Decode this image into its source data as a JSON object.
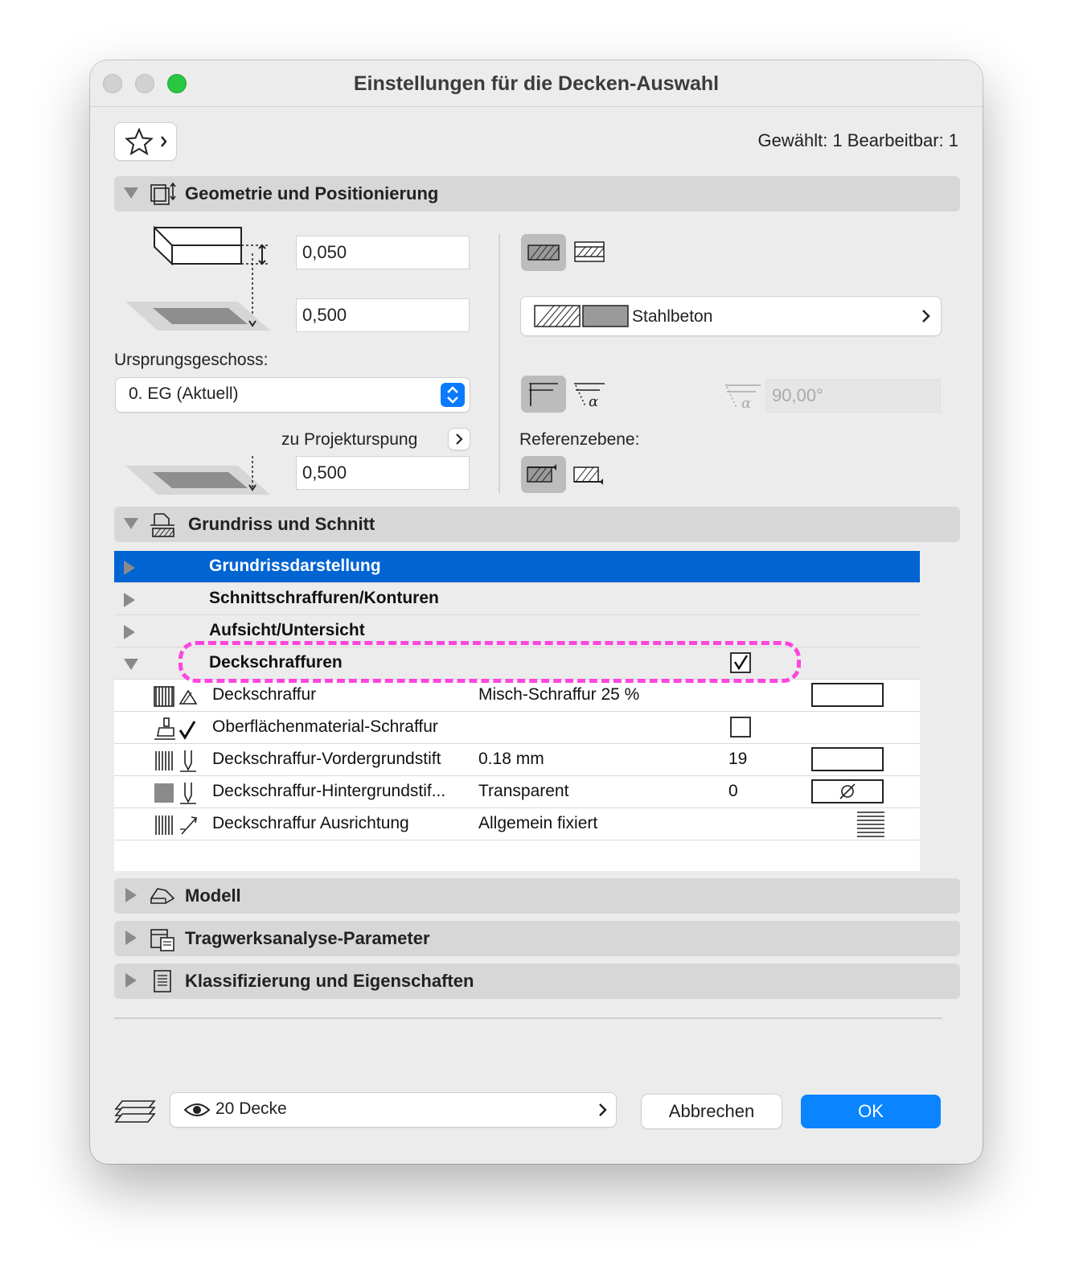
{
  "window": {
    "title": "Einstellungen für die Decken-Auswahl"
  },
  "header": {
    "selection_info": "Gewählt: 1 Bearbeitbar: 1"
  },
  "sections": {
    "geometry": "Geometrie und Positionierung",
    "floorplan": "Grundriss und Schnitt",
    "model": "Modell",
    "structural": "Tragwerksanalyse-Parameter",
    "classification": "Klassifizierung und Eigenschaften"
  },
  "geometry": {
    "thickness": "0,050",
    "offset": "0,500",
    "home_story_label": "Ursprungsgeschoss:",
    "home_story_value": "0. EG (Aktuell)",
    "to_project_zero_label": "zu Projekturspung",
    "to_project_zero_value": "0,500",
    "material_name": "Stahlbeton",
    "angle_value": "90,00°",
    "reference_plane_label": "Referenzebene:"
  },
  "tree": {
    "categories": [
      {
        "label": "Grundrissdarstellung"
      },
      {
        "label": "Schnittschraffuren/Konturen"
      },
      {
        "label": "Aufsicht/Untersicht"
      },
      {
        "label": "Deckschraffuren"
      }
    ],
    "params": [
      {
        "name": "Deckschraffur",
        "value": "Misch-Schraffur 25 %",
        "num": ""
      },
      {
        "name": "Oberflächenmaterial-Schraffur",
        "value": "",
        "num": ""
      },
      {
        "name": "Deckschraffur-Vordergrundstift",
        "value": "0.18 mm",
        "num": "19"
      },
      {
        "name": "Deckschraffur-Hintergrundstif...",
        "value": "Transparent",
        "num": "0"
      },
      {
        "name": "Deckschraffur Ausrichtung",
        "value": "Allgemein fixiert",
        "num": ""
      }
    ]
  },
  "footer": {
    "layer": "20 Decke",
    "cancel": "Abbrechen",
    "ok": "OK"
  },
  "colors": {
    "accent": "#0a84ff",
    "selection": "#0064d2",
    "highlight": "#ff33dd"
  }
}
